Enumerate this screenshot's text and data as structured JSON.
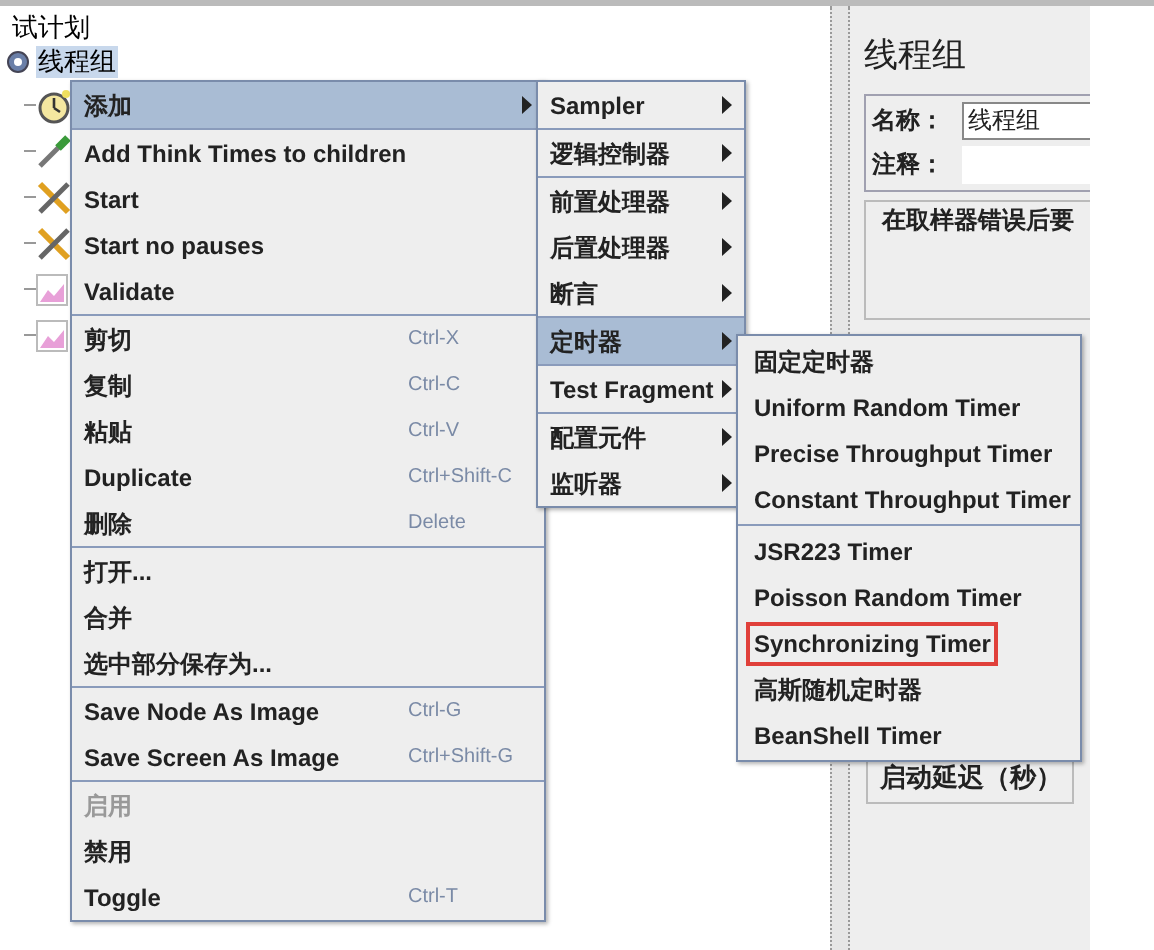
{
  "tree": {
    "root": "试计划",
    "node": {
      "label": "线程组",
      "selected": true
    }
  },
  "panel": {
    "title": "线程组",
    "name_label": "名称：",
    "name_value": "线程组",
    "comment_label": "注释：",
    "error_group": "在取样器错误后要",
    "delay_label": "启动延迟（秒）"
  },
  "context_menu": {
    "groups": [
      {
        "items": [
          {
            "label": "添加",
            "kind": "submenu",
            "selected": true,
            "disabled": false
          }
        ]
      },
      {
        "items": [
          {
            "label": "Add Think Times to children",
            "kind": "action",
            "selected": false,
            "disabled": false
          },
          {
            "label": "Start",
            "kind": "action",
            "selected": false,
            "disabled": false
          },
          {
            "label": "Start no pauses",
            "kind": "action",
            "selected": false,
            "disabled": false
          },
          {
            "label": "Validate",
            "kind": "action",
            "selected": false,
            "disabled": false
          }
        ]
      },
      {
        "items": [
          {
            "label": "剪切",
            "shortcut": "Ctrl-X",
            "kind": "action",
            "selected": false,
            "disabled": false
          },
          {
            "label": "复制",
            "shortcut": "Ctrl-C",
            "kind": "action",
            "selected": false,
            "disabled": false
          },
          {
            "label": "粘贴",
            "shortcut": "Ctrl-V",
            "kind": "action",
            "selected": false,
            "disabled": false
          },
          {
            "label": "Duplicate",
            "shortcut": "Ctrl+Shift-C",
            "kind": "action",
            "selected": false,
            "disabled": false
          },
          {
            "label": "删除",
            "shortcut": "Delete",
            "kind": "action",
            "selected": false,
            "disabled": false
          }
        ]
      },
      {
        "items": [
          {
            "label": "打开...",
            "kind": "action",
            "selected": false,
            "disabled": false
          },
          {
            "label": "合并",
            "kind": "action",
            "selected": false,
            "disabled": false
          },
          {
            "label": "选中部分保存为...",
            "kind": "action",
            "selected": false,
            "disabled": false
          }
        ]
      },
      {
        "items": [
          {
            "label": "Save Node As Image",
            "shortcut": "Ctrl-G",
            "kind": "action",
            "selected": false,
            "disabled": false
          },
          {
            "label": "Save Screen As Image",
            "shortcut": "Ctrl+Shift-G",
            "kind": "action",
            "selected": false,
            "disabled": false
          }
        ]
      },
      {
        "items": [
          {
            "label": "启用",
            "kind": "action",
            "selected": false,
            "disabled": true
          },
          {
            "label": "禁用",
            "kind": "action",
            "selected": false,
            "disabled": false
          },
          {
            "label": "Toggle",
            "shortcut": "Ctrl-T",
            "kind": "action",
            "selected": false,
            "disabled": false
          }
        ]
      }
    ]
  },
  "add_submenu": {
    "groups": [
      {
        "items": [
          {
            "label": "Sampler",
            "kind": "submenu",
            "selected": false
          }
        ]
      },
      {
        "items": [
          {
            "label": "逻辑控制器",
            "kind": "submenu",
            "selected": false
          }
        ]
      },
      {
        "items": [
          {
            "label": "前置处理器",
            "kind": "submenu",
            "selected": false
          },
          {
            "label": "后置处理器",
            "kind": "submenu",
            "selected": false
          },
          {
            "label": "断言",
            "kind": "submenu",
            "selected": false
          }
        ]
      },
      {
        "items": [
          {
            "label": "定时器",
            "kind": "submenu",
            "selected": true
          }
        ]
      },
      {
        "items": [
          {
            "label": "Test Fragment",
            "kind": "submenu",
            "selected": false
          }
        ]
      },
      {
        "items": [
          {
            "label": "配置元件",
            "kind": "submenu",
            "selected": false
          },
          {
            "label": "监听器",
            "kind": "submenu",
            "selected": false
          }
        ]
      }
    ]
  },
  "timer_submenu": {
    "groups": [
      {
        "items": [
          {
            "label": "固定定时器",
            "highlighted": false
          },
          {
            "label": "Uniform Random Timer",
            "highlighted": false
          },
          {
            "label": "Precise Throughput Timer",
            "highlighted": false
          },
          {
            "label": "Constant Throughput Timer",
            "highlighted": false
          }
        ]
      },
      {
        "items": [
          {
            "label": "JSR223 Timer",
            "highlighted": false
          },
          {
            "label": "Poisson Random Timer",
            "highlighted": false
          },
          {
            "label": "Synchronizing Timer",
            "highlighted": true
          },
          {
            "label": "高斯随机定时器",
            "highlighted": false
          },
          {
            "label": "BeanShell Timer",
            "highlighted": false
          }
        ]
      }
    ]
  }
}
